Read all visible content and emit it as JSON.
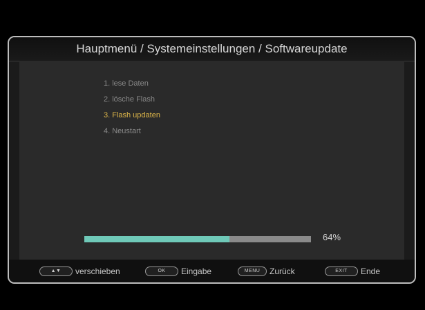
{
  "header": {
    "breadcrumb": "Hauptmenü / Systemeinstellungen / Softwareupdate"
  },
  "steps": [
    {
      "label": "1. lese Daten",
      "state": "done"
    },
    {
      "label": "2. lösche Flash",
      "state": "done"
    },
    {
      "label": "3. Flash updaten",
      "state": "active"
    },
    {
      "label": "4. Neustart",
      "state": "pending"
    }
  ],
  "progress": {
    "percent_value": 64,
    "label": "64%"
  },
  "footer": {
    "move": {
      "key": "▲▼",
      "label": "verschieben"
    },
    "ok": {
      "key": "OK",
      "label": "Eingabe"
    },
    "menu": {
      "key": "MENU",
      "label": "Zurück"
    },
    "exit": {
      "key": "EXIT",
      "label": "Ende"
    }
  },
  "colors": {
    "accent_active": "#e0b84a",
    "progress_fill": "#6fc9b8",
    "progress_track": "#8a8a8a"
  }
}
